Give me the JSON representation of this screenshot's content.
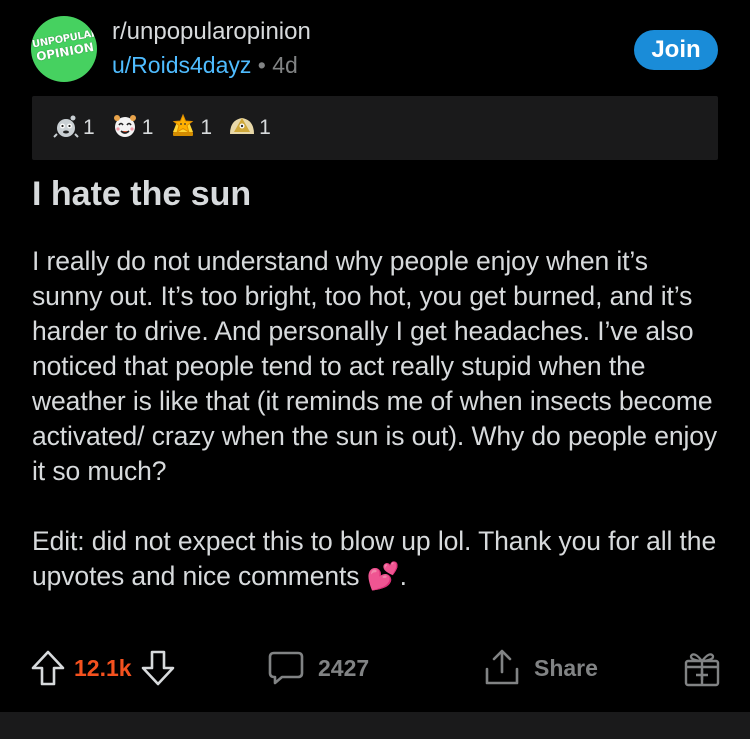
{
  "header": {
    "subreddit": "r/unpopularopinion",
    "user": "u/Roids4dayz",
    "separator": "•",
    "age": "4d",
    "join_label": "Join",
    "logo_line1": "UNPOPULAR",
    "logo_line2": "OPINION"
  },
  "awards": [
    {
      "icon": "silver-award-icon",
      "count": "1"
    },
    {
      "icon": "wholesome-award-icon",
      "count": "1"
    },
    {
      "icon": "gold-star-award-icon",
      "count": "1"
    },
    {
      "icon": "helpful-award-icon",
      "count": "1"
    }
  ],
  "post": {
    "title": "I hate the sun",
    "paragraph1": "I really do not understand why people enjoy when it’s sunny out.  It’s too bright, too hot, you get burned, and it’s harder to drive.  And personally I get headaches.  I’ve also noticed that people tend to act really stupid when the weather is like that (it reminds me of when insects become activated/ crazy when the sun is out).  Why do people enjoy it so much?",
    "paragraph2": "Edit: did not expect this to blow up lol.  Thank you for all the upvotes and nice comments 💕."
  },
  "actions": {
    "score": "12.1k",
    "comments": "2427",
    "share_label": "Share"
  },
  "colors": {
    "accent": "#1a8cd8",
    "upvote": "#f4511e",
    "username": "#4fbcff",
    "subreddit_icon": "#46d160"
  }
}
